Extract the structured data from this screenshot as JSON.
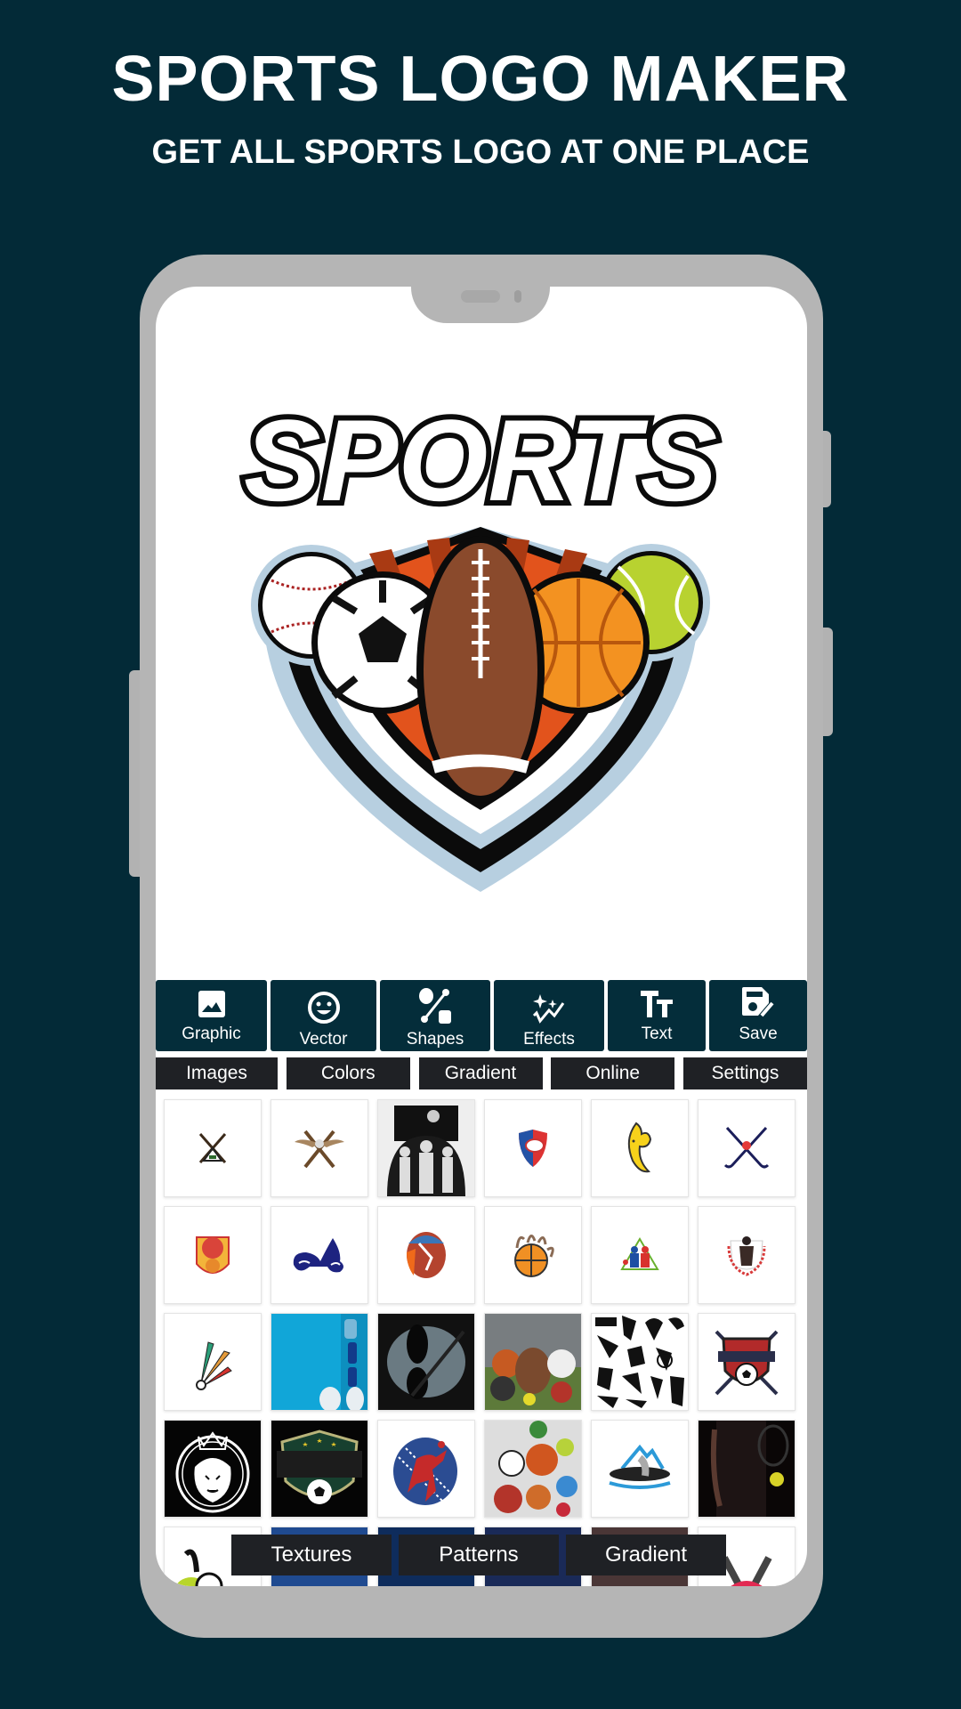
{
  "promo": {
    "title": "SPORTS LOGO MAKER",
    "subtitle": "GET ALL SPORTS LOGO AT ONE PLACE"
  },
  "colors": {
    "background": "#032a37",
    "toolbar": "#042d3a",
    "tab": "#1f2125",
    "phone_frame": "#b5b5b5"
  },
  "canvas": {
    "logo_text": "SPORTS",
    "logo_icon": "sports-shield-logo"
  },
  "toolbar": {
    "items": [
      {
        "label": "Graphic",
        "icon": "image-icon"
      },
      {
        "label": "Vector",
        "icon": "smiley-icon"
      },
      {
        "label": "Shapes",
        "icon": "shapes-icon"
      },
      {
        "label": "Effects",
        "icon": "sparkle-icon"
      },
      {
        "label": "Text",
        "icon": "text-size-icon"
      },
      {
        "label": "Save",
        "icon": "save-edit-icon"
      }
    ]
  },
  "tabs": {
    "items": [
      {
        "label": "Images"
      },
      {
        "label": "Colors"
      },
      {
        "label": "Gradient"
      },
      {
        "label": "Online"
      },
      {
        "label": "Settings"
      }
    ]
  },
  "grid": {
    "items": [
      {
        "name": "rifle-deer-logo"
      },
      {
        "name": "winged-bats-logo"
      },
      {
        "name": "team-silhouette-logo"
      },
      {
        "name": "rugby-shield-logo"
      },
      {
        "name": "banana-muscle-logo"
      },
      {
        "name": "hockey-sticks-logo"
      },
      {
        "name": "basketball-mascot-logo"
      },
      {
        "name": "motorbike-logo"
      },
      {
        "name": "cricket-batsman-logo"
      },
      {
        "name": "claw-basketball-logo"
      },
      {
        "name": "table-tennis-logo"
      },
      {
        "name": "boxer-laurel-logo"
      },
      {
        "name": "shuttlecock-logo"
      },
      {
        "name": "fitness-photo"
      },
      {
        "name": "barbell-photo"
      },
      {
        "name": "sports-balls-photo"
      },
      {
        "name": "silhouettes-logo"
      },
      {
        "name": "soccer-shield-swords-logo"
      },
      {
        "name": "lion-crown-logo"
      },
      {
        "name": "soccer-badge-logo"
      },
      {
        "name": "cricket-bowler-logo"
      },
      {
        "name": "balls-pile-photo"
      },
      {
        "name": "kayak-mountain-logo"
      },
      {
        "name": "tennis-player-photo"
      },
      {
        "name": "sneakers-soccer-logo"
      },
      {
        "name": "blue-photo"
      },
      {
        "name": "blue-photo-2"
      },
      {
        "name": "dark-photo"
      },
      {
        "name": "court-photo"
      },
      {
        "name": "lips-logo"
      }
    ]
  },
  "bottom_tabs": {
    "items": [
      {
        "label": "Textures"
      },
      {
        "label": "Patterns"
      },
      {
        "label": "Gradient"
      }
    ]
  }
}
